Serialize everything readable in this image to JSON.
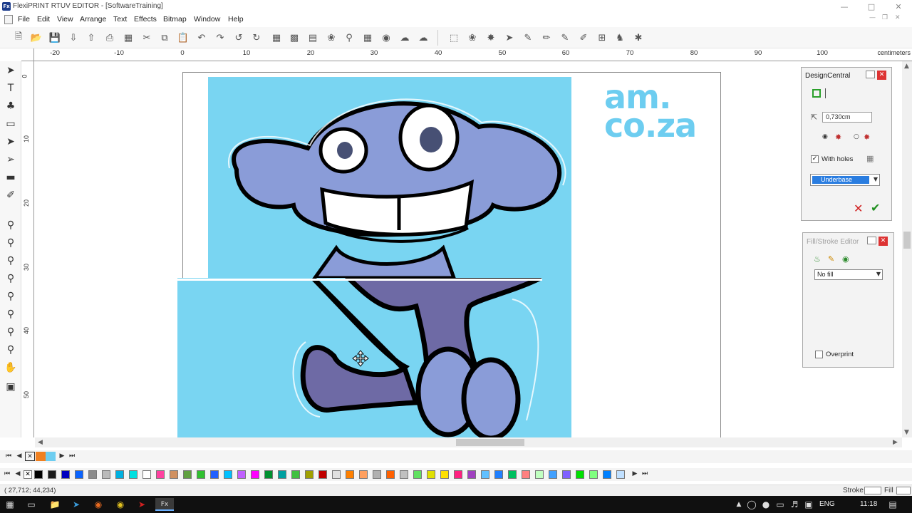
{
  "window": {
    "title": "FlexiPRINT RTUV EDITOR - [SoftwareTraining]",
    "app_icon_text": "Fx",
    "controls": [
      "minimize-icon",
      "maximize-icon",
      "close-icon"
    ]
  },
  "menubar": {
    "items": [
      "File",
      "Edit",
      "View",
      "Arrange",
      "Text",
      "Effects",
      "Bitmap",
      "Window",
      "Help"
    ]
  },
  "ruler": {
    "h_labels": [
      "-20",
      "-10",
      "0",
      "10",
      "20",
      "30",
      "40",
      "50",
      "60",
      "70",
      "80",
      "90",
      "100"
    ],
    "unit": "centimeters",
    "v_labels": [
      "0",
      "10",
      "20",
      "30",
      "40",
      "50"
    ]
  },
  "canvas": {
    "logo_line1": "am.",
    "logo_line2": "co.za",
    "image_color": "#79d5f2"
  },
  "design_central": {
    "title": "DesignCentral",
    "offset_value": "0,730cm",
    "with_holes_label": "With holes",
    "with_holes_checked": true,
    "layer_select": "Underbase"
  },
  "fill_stroke_editor": {
    "title": "Fill/Stroke Editor",
    "fill_select": "No fill",
    "overprint_label": "Overprint",
    "overprint_checked": false
  },
  "status": {
    "coords": "( 27,712;    44,234)",
    "stroke_label": "Stroke",
    "fill_label": "Fill"
  },
  "taskbar": {
    "language": "ENG",
    "time": "11:18"
  },
  "palette": {
    "colors": [
      "#000000",
      "#1a1a1a",
      "#0000c0",
      "#0a64ff",
      "#8a8a8a",
      "#bababa",
      "#00b0e0",
      "#00e0e0",
      "#ffffff",
      "#ff40a0",
      "#d09060",
      "#60a040",
      "#30c030",
      "#2060ff",
      "#00c0ff",
      "#c060ff",
      "#ff00ff",
      "#009030",
      "#00a0a0",
      "#40c040",
      "#a0a000",
      "#c00000",
      "#e0e0e0",
      "#ff8000",
      "#ffa060",
      "#b0b0b0",
      "#ff6000",
      "#c0c0c0",
      "#60e060",
      "#e0e000",
      "#ffe000",
      "#ff2080",
      "#a040c0",
      "#60c0ff",
      "#2080ff",
      "#00c060",
      "#ff8080",
      "#c0ffc0",
      "#40a0ff",
      "#8060ff",
      "#00e000",
      "#80ff80",
      "#0080ff",
      "#c0e0ff"
    ]
  }
}
